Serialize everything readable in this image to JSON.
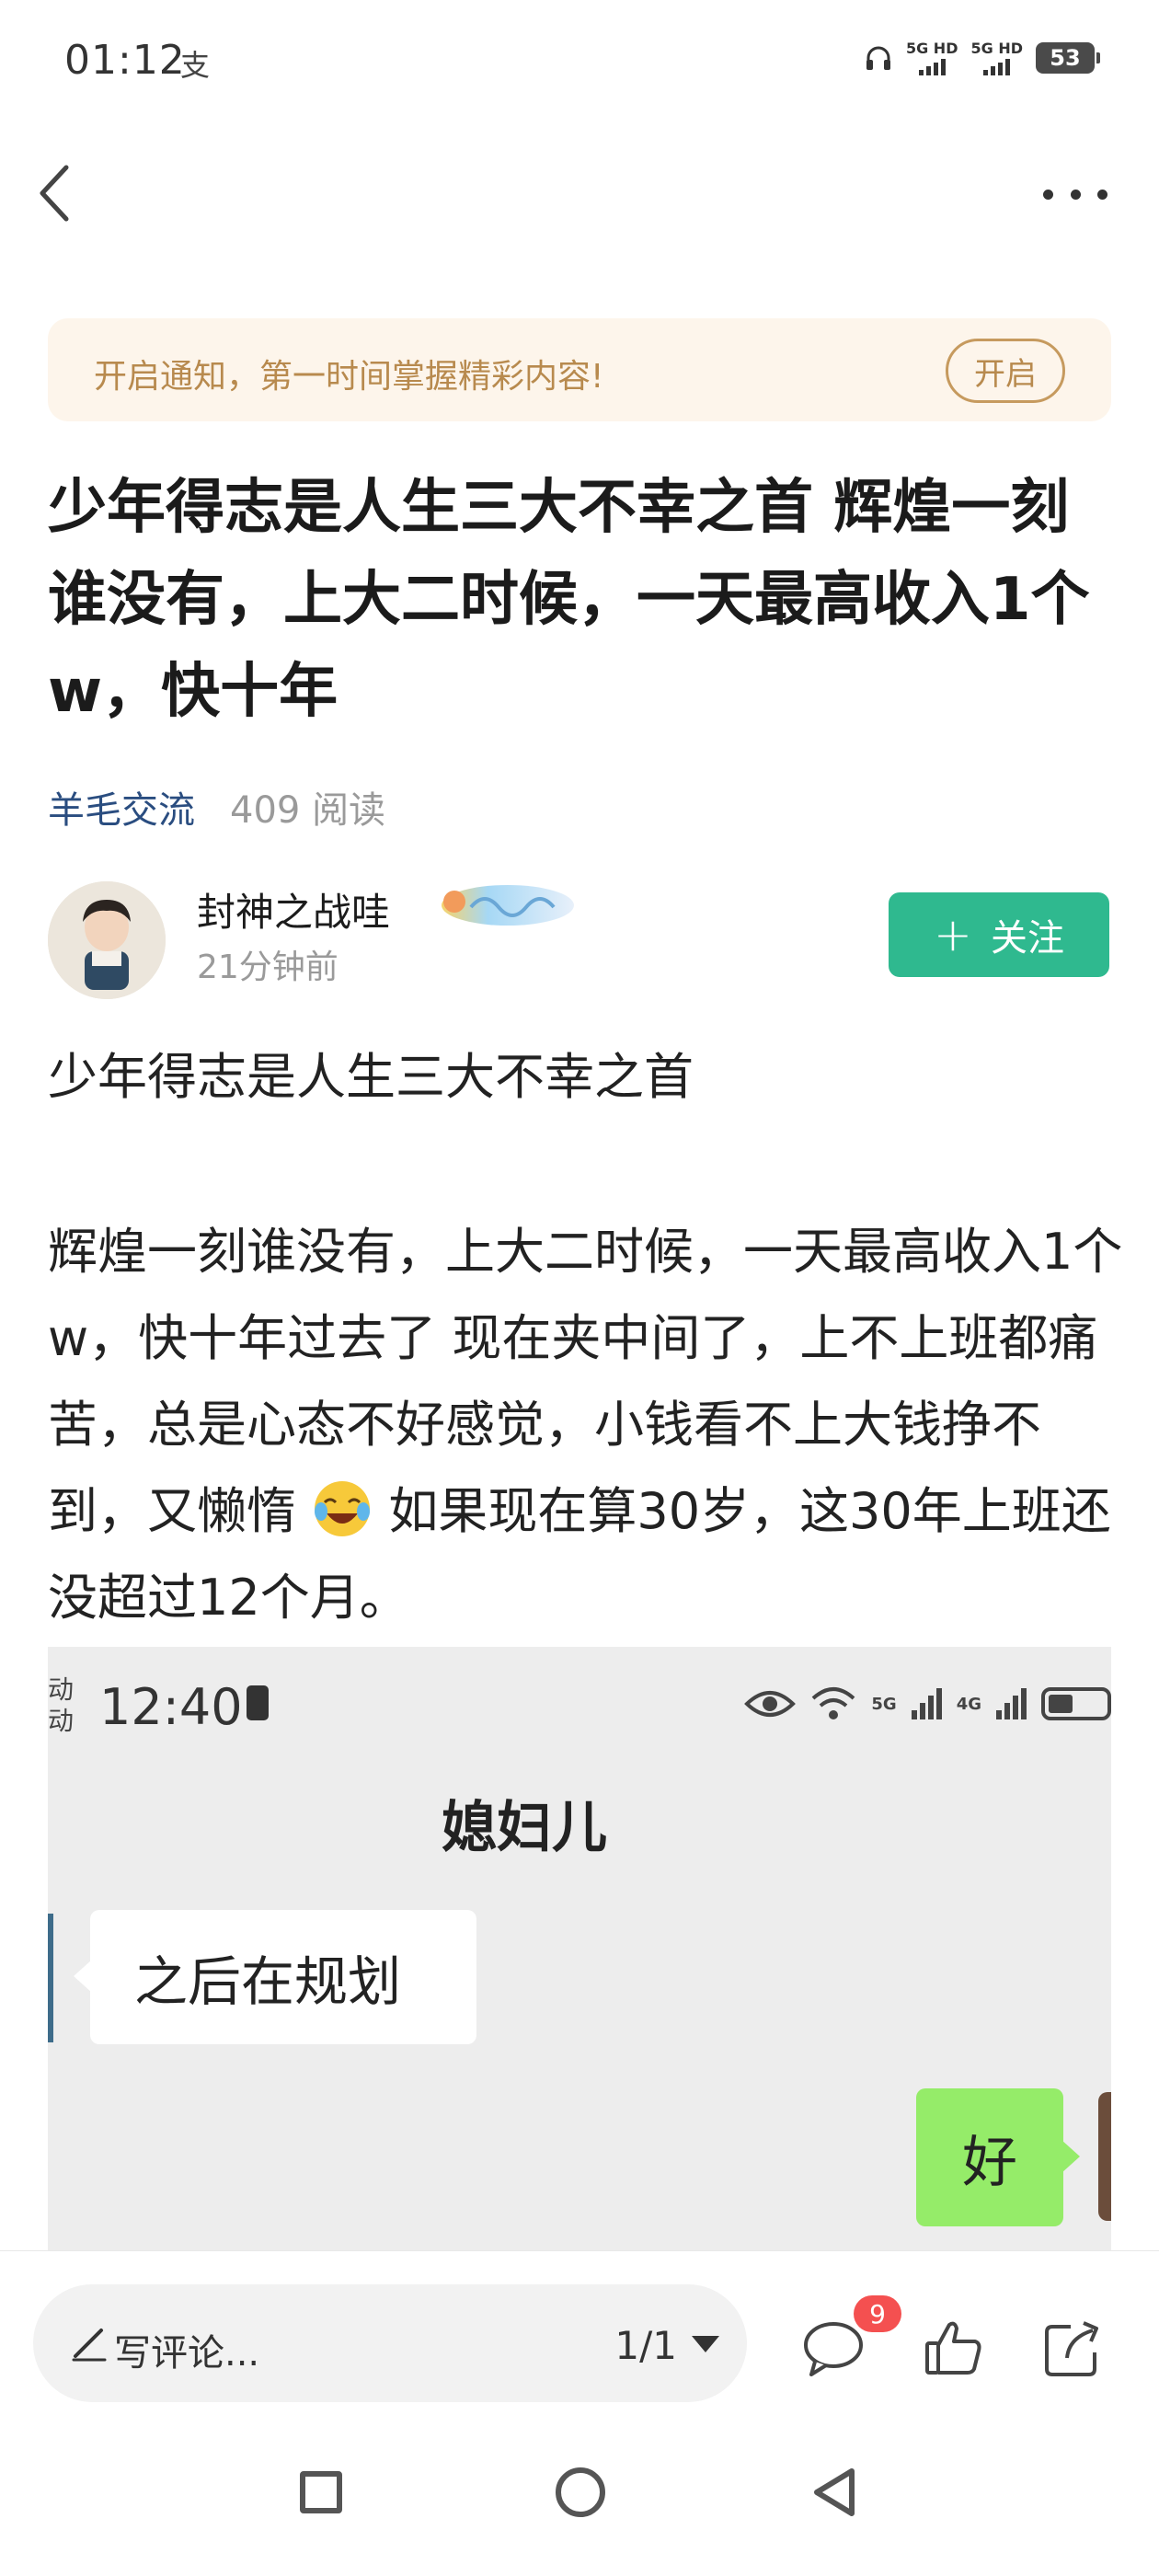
{
  "status_bar": {
    "time": "01:12",
    "extra": "支",
    "signal1": "5G HD",
    "signal2": "5G HD",
    "battery": "53"
  },
  "notify": {
    "text": "开启通知，第一时间掌握精彩内容!",
    "button": "开启"
  },
  "article": {
    "title": "少年得志是人生三大不幸之首 辉煌一刻谁没有，上大二时候，一天最高收入1个w，快十年",
    "tag": "羊毛交流",
    "reads": "409 阅读",
    "author": "封神之战哇",
    "time": "21分钟前",
    "follow_label": "关注",
    "paragraph1": "少年得志是人生三大不幸之首",
    "paragraph2_a": "辉煌一刻谁没有，上大二时候，一天最高收入1个w，快十年过去了 现在夹中间了，上不上班都痛苦，总是心态不好感觉，小钱看不上大钱挣不到，又懒惰",
    "paragraph2_b": "如果现在算30岁，这30年上班还没超过12个月。",
    "emoji_icon": "crying-laughing-emoji-icon"
  },
  "screenshot": {
    "carrier": "移动\n移动",
    "time": "12:40",
    "net1": "5G",
    "net2": "4G",
    "chat_title": "媳妇儿",
    "msg_left": "之后在规划",
    "msg_right": "好"
  },
  "bottom_bar": {
    "comment_placeholder": "写评论...",
    "page_indicator": "1/1",
    "comment_count": "9"
  },
  "colors": {
    "follow": "#2fb98f",
    "tag": "#2a4d80",
    "notify_bg": "#fdf5eb",
    "notify_text": "#b88a4e",
    "wechat_green": "#95ec69",
    "badge_red": "#f45050"
  }
}
